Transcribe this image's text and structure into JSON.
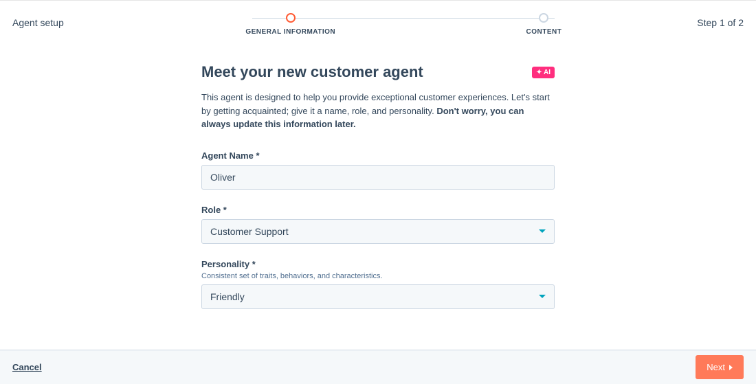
{
  "header": {
    "title": "Agent setup",
    "step_indicator": "Step 1 of 2"
  },
  "stepper": {
    "steps": [
      {
        "label": "GENERAL INFORMATION",
        "active": true
      },
      {
        "label": "CONTENT",
        "active": false
      }
    ]
  },
  "main": {
    "title": "Meet your new customer agent",
    "ai_badge": "✦ AI",
    "description_plain": "This agent is designed to help you provide exceptional customer experiences. Let's start by getting acquainted; give it a name, role, and personality. ",
    "description_bold": "Don't worry, you can always update this information later.",
    "fields": {
      "agent_name": {
        "label": "Agent Name *",
        "value": "Oliver"
      },
      "role": {
        "label": "Role *",
        "value": "Customer Support"
      },
      "personality": {
        "label": "Personality *",
        "hint": "Consistent set of traits, behaviors, and characteristics.",
        "value": "Friendly"
      }
    }
  },
  "footer": {
    "cancel": "Cancel",
    "next": "Next"
  }
}
